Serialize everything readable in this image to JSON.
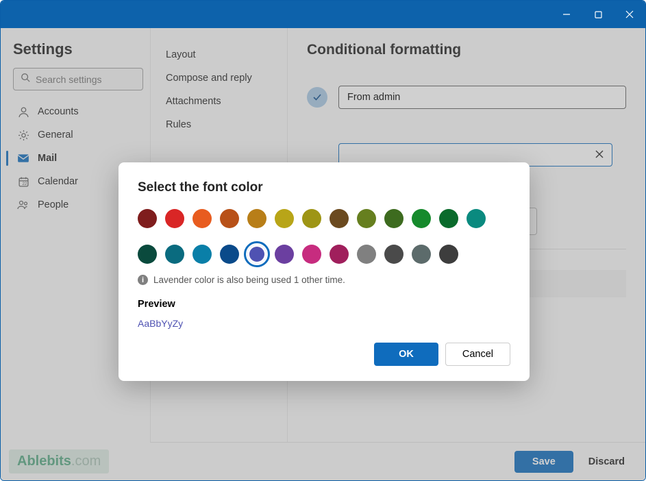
{
  "titlebar": {
    "minimize": "minimize",
    "maximize": "maximize",
    "close": "close"
  },
  "sidebar": {
    "title": "Settings",
    "search_placeholder": "Search settings",
    "items": [
      {
        "label": "Accounts",
        "icon": "person"
      },
      {
        "label": "General",
        "icon": "gear"
      },
      {
        "label": "Mail",
        "icon": "mail",
        "active": true
      },
      {
        "label": "Calendar",
        "icon": "calendar"
      },
      {
        "label": "People",
        "icon": "people"
      }
    ]
  },
  "subnav": {
    "items": [
      {
        "label": "Layout"
      },
      {
        "label": "Compose and reply"
      },
      {
        "label": "Attachments"
      },
      {
        "label": "Rules"
      }
    ]
  },
  "main": {
    "heading": "Conditional formatting",
    "rule_name": "From admin"
  },
  "dialog": {
    "title": "Select the font color",
    "info_text": "Lavender color is also being used 1 other time.",
    "preview_label": "Preview",
    "preview_text": "AaBbYyZy",
    "preview_color": "#4f52b2",
    "ok_label": "OK",
    "cancel_label": "Cancel",
    "selected_color": "Lavender",
    "colors_row1": [
      "#7f1d1d",
      "#d92626",
      "#e85c1f",
      "#b85118",
      "#b87e18",
      "#b8a518",
      "#9e9515",
      "#6b4a1f",
      "#667f1f",
      "#3d6b1f",
      "#168a2c",
      "#0a6b2c",
      "#0a8a7f"
    ],
    "colors_row2": [
      "#0a4a3d",
      "#0a6b7f",
      "#0a7fa8",
      "#0a4a8a",
      "#4f52b2",
      "#6b3fa0",
      "#c72c7f",
      "#a01f5c",
      "#808080",
      "#4a4a4a",
      "#5c6b6b",
      "#3d3d3d"
    ]
  },
  "footer": {
    "save_label": "Save",
    "discard_label": "Discard"
  },
  "watermark": {
    "brand": "Ablebits",
    "suffix": ".com"
  }
}
